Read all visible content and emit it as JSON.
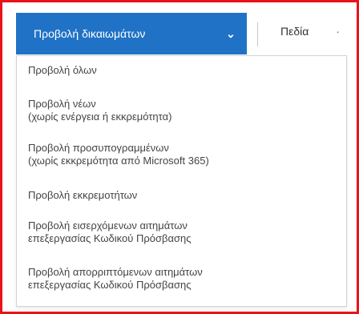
{
  "toolbar": {
    "view_button_label": "Προβολή δικαιωμάτων",
    "view_button_chevron": "⌄",
    "fields_label": "Πεδία",
    "more_label": "·"
  },
  "menu": {
    "items": [
      {
        "line1": "Προβολή όλων",
        "line2": ""
      },
      {
        "line1": "Προβολή νέων",
        "line2": "(χωρίς ενέργεια ή εκκρεμότητα)"
      },
      {
        "line1": "Προβολή προσυπογραμμένων",
        "line2": "(χωρίς εκκρεμότητα από Microsoft 365)"
      },
      {
        "line1": "Προβολή εκκρεμοτήτων",
        "line2": ""
      },
      {
        "line1": "Προβολή εισερχόμενων αιτημάτων",
        "line2": "επεξεργασίας Κωδικού Πρόσβασης"
      },
      {
        "line1": "Προβολή απορριπτόμενων αιτημάτων",
        "line2": "επεξεργασίας Κωδικού Πρόσβασης"
      }
    ]
  },
  "colors": {
    "frame_border": "#e8141b",
    "button_bg": "#2072c6",
    "button_text": "#ffffff",
    "menu_text": "#444444"
  }
}
